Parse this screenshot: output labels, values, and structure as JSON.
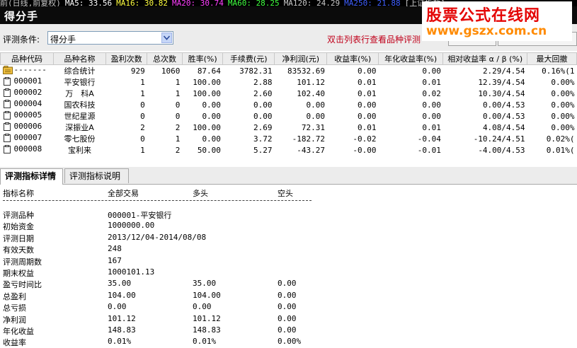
{
  "indicator_strip": {
    "items": [
      {
        "text": "前(日线,前复权)",
        "color": "#c8c8c8"
      },
      {
        "text": "MA5: 33.56",
        "color": "#ffffff"
      },
      {
        "text": "MA16: 30.82",
        "color": "#ffff40"
      },
      {
        "text": "MA20: 30.74",
        "color": "#ff40ff"
      },
      {
        "text": "MA60: 28.25",
        "color": "#40ff40"
      },
      {
        "text": "MA120: 24.29",
        "color": "#c8c8c8"
      },
      {
        "text": "MA250: 21.88",
        "color": "#4060ff"
      },
      {
        "text": "[上证指数]",
        "color": "#c8c8c8"
      }
    ]
  },
  "window": {
    "title": "得分手"
  },
  "criteria": {
    "label": "评测条件:",
    "selected": "得分手",
    "hint": "双击列表行查看品种评测"
  },
  "watermark": {
    "line1": "股票公式在线网",
    "line2": "www.gszx.com.cn",
    "color1": "#e40505",
    "color2": "#ff8a00"
  },
  "table": {
    "headers": [
      "品种代码",
      "品种名称",
      "盈利次数",
      "总次数",
      "胜率(%)",
      "手续费(元)",
      "净利润(元)",
      "收益率(%)",
      "年化收益率(%)",
      "相对收益率 α / β (%)",
      "最大回撤"
    ],
    "rows": [
      {
        "code": "-------",
        "name": "综合统计",
        "win": "929",
        "total": "1060",
        "rate": "87.64",
        "fee": "3782.31",
        "profit": "83532.69",
        "ret": "0.00",
        "annual": "0.00",
        "rel": "2.29/4.54",
        "dd": "0.16%(1",
        "icon": "summary"
      },
      {
        "code": "000001",
        "name": "平安银行",
        "win": "1",
        "total": "1",
        "rate": "100.00",
        "fee": "2.88",
        "profit": "101.12",
        "ret": "0.01",
        "annual": "0.01",
        "rel": "12.39/4.54",
        "dd": "0.00%",
        "icon": "doc"
      },
      {
        "code": "000002",
        "name": "万　科A",
        "win": "1",
        "total": "1",
        "rate": "100.00",
        "fee": "2.60",
        "profit": "102.40",
        "ret": "0.01",
        "annual": "0.02",
        "rel": "10.30/4.54",
        "dd": "0.00%",
        "icon": "doc"
      },
      {
        "code": "000004",
        "name": "国农科技",
        "win": "0",
        "total": "0",
        "rate": "0.00",
        "fee": "0.00",
        "profit": "0.00",
        "ret": "0.00",
        "annual": "0.00",
        "rel": "0.00/4.53",
        "dd": "0.00%",
        "icon": "doc"
      },
      {
        "code": "000005",
        "name": "世纪星源",
        "win": "0",
        "total": "0",
        "rate": "0.00",
        "fee": "0.00",
        "profit": "0.00",
        "ret": "0.00",
        "annual": "0.00",
        "rel": "0.00/4.53",
        "dd": "0.00%",
        "icon": "doc"
      },
      {
        "code": "000006",
        "name": "深振业A",
        "win": "2",
        "total": "2",
        "rate": "100.00",
        "fee": "2.69",
        "profit": "72.31",
        "ret": "0.01",
        "annual": "0.01",
        "rel": "4.08/4.54",
        "dd": "0.00%",
        "icon": "doc"
      },
      {
        "code": "000007",
        "name": "零七股份",
        "win": "0",
        "total": "1",
        "rate": "0.00",
        "fee": "3.72",
        "profit": "-182.72",
        "ret": "-0.02",
        "annual": "-0.04",
        "rel": "-10.24/4.51",
        "dd": "0.02%(",
        "icon": "doc"
      },
      {
        "code": "000008",
        "name": "宝利来",
        "win": "1",
        "total": "2",
        "rate": "50.00",
        "fee": "5.27",
        "profit": "-43.27",
        "ret": "-0.00",
        "annual": "-0.01",
        "rel": "-4.00/4.53",
        "dd": "0.01%(",
        "icon": "doc"
      }
    ]
  },
  "tabs": [
    {
      "label": "评测指标详情",
      "active": true
    },
    {
      "label": "评测指标说明",
      "active": false
    }
  ],
  "details": {
    "headers": [
      "指标名称",
      "全部交易",
      "多头",
      "空头"
    ],
    "divider": "------------------------------------------------------------------------",
    "rows": [
      {
        "name": "评测品种",
        "all": "000001-平安银行",
        "long": "",
        "short": ""
      },
      {
        "name": "初始资金",
        "all": "1000000.00",
        "long": "",
        "short": ""
      },
      {
        "name": "评测日期",
        "all": "2013/12/04-2014/08/08",
        "long": "",
        "short": ""
      },
      {
        "name": "有效天数",
        "all": "248",
        "long": "",
        "short": ""
      },
      {
        "name": "评测周期数",
        "all": "167",
        "long": "",
        "short": ""
      },
      {
        "name": "期末权益",
        "all": "1000101.13",
        "long": "",
        "short": ""
      },
      {
        "name": "盈亏时间比",
        "all": "35.00",
        "long": "35.00",
        "short": "0.00"
      },
      {
        "name": "总盈利",
        "all": "104.00",
        "long": "104.00",
        "short": "0.00"
      },
      {
        "name": "总亏损",
        "all": "0.00",
        "long": "0.00",
        "short": "0.00"
      },
      {
        "name": "净利润",
        "all": "101.12",
        "long": "101.12",
        "short": "0.00"
      },
      {
        "name": "年化收益",
        "all": "148.83",
        "long": "148.83",
        "short": "0.00"
      },
      {
        "name": "收益率",
        "all": "0.01%",
        "long": "0.01%",
        "short": "0.00%"
      }
    ]
  }
}
